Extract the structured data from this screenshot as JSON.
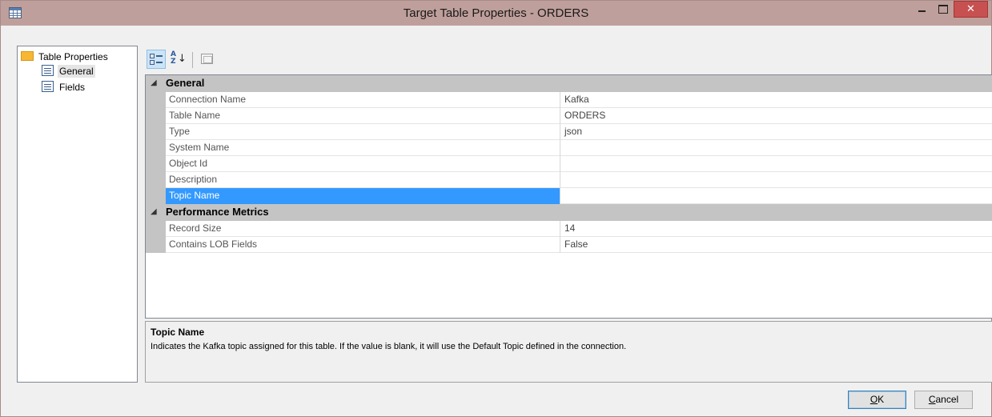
{
  "window": {
    "title": "Target Table Properties - ORDERS"
  },
  "titlebar_buttons": {
    "close_glyph": "✕"
  },
  "tree": {
    "root_label": "Table Properties",
    "items": [
      {
        "label": "General",
        "icon": "document-icon",
        "selected": true
      },
      {
        "label": "Fields",
        "icon": "document-icon",
        "selected": false
      }
    ]
  },
  "toolbar": {
    "az_glyph": "A\nZ",
    "az_arrow": "↓"
  },
  "grid": {
    "categories": [
      {
        "toggle": "◢",
        "label": "General",
        "rows": [
          {
            "name": "Connection Name",
            "value": "Kafka"
          },
          {
            "name": "Table Name",
            "value": "ORDERS"
          },
          {
            "name": "Type",
            "value": "json"
          },
          {
            "name": "System Name",
            "value": ""
          },
          {
            "name": "Object Id",
            "value": ""
          },
          {
            "name": "Description",
            "value": ""
          },
          {
            "name": "Topic Name",
            "value": "",
            "selected": true
          }
        ]
      },
      {
        "toggle": "◢",
        "label": "Performance Metrics",
        "rows": [
          {
            "name": "Record Size",
            "value": "14"
          },
          {
            "name": "Contains LOB Fields",
            "value": "False"
          }
        ]
      }
    ]
  },
  "help": {
    "title": "Topic Name",
    "description": "Indicates the Kafka topic assigned for this table. If the value is blank, it will use the Default Topic defined in the connection."
  },
  "buttons": {
    "ok_accel": "O",
    "ok_rest": "K",
    "cancel_accel": "C",
    "cancel_rest": "ancel"
  },
  "colors": {
    "titlebar": "#bf9f9b",
    "selection": "#3399ff",
    "category_band": "#c4c4c4",
    "close_button": "#c75050"
  }
}
